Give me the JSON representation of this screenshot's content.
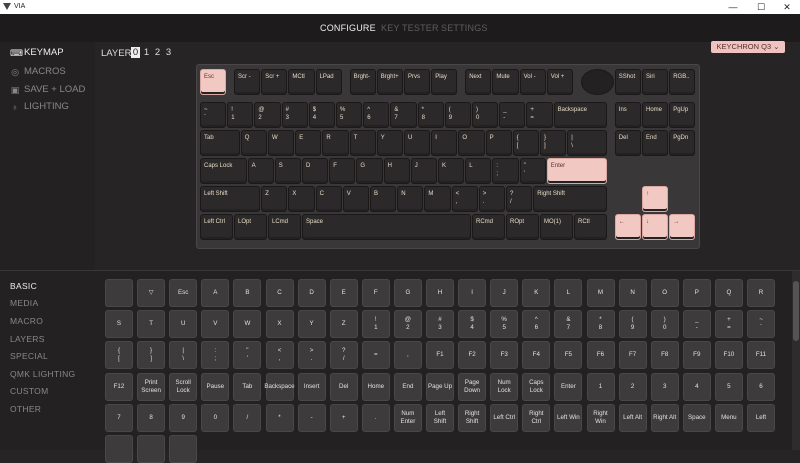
{
  "window": {
    "title": "VIA",
    "controls": [
      "—",
      "☐",
      "✕"
    ]
  },
  "nav": {
    "tabs": [
      "CONFIGURE",
      "KEY TESTER",
      "SETTINGS"
    ],
    "active": 0
  },
  "sidebar": {
    "items": [
      {
        "label": "KEYMAP",
        "icon": "keyboard-icon",
        "active": true
      },
      {
        "label": "MACROS",
        "icon": "macro-icon",
        "active": false
      },
      {
        "label": "SAVE + LOAD",
        "icon": "save-icon",
        "active": false
      },
      {
        "label": "LIGHTING",
        "icon": "lightbulb-icon",
        "active": false
      }
    ]
  },
  "layer": {
    "label": "LAYER",
    "numbers": [
      "0",
      "1",
      "2",
      "3"
    ],
    "selected": 0
  },
  "keyboard_select": {
    "value": "KEYCHRON Q3 ⌄"
  },
  "keyboard_rows": [
    [
      "Esc",
      "Scr -",
      "Scr +",
      "MCtl",
      "LPad",
      "Brght-",
      "Brght+",
      "Prvs",
      "Play",
      "Next",
      "Mute",
      "Vol -",
      "Vol +",
      "",
      "SShot",
      "Siri",
      "RGB.."
    ],
    [
      "~\n`",
      "!\n1",
      "@\n2",
      "#\n3",
      "$\n4",
      "%\n5",
      "^\n6",
      "&\n7",
      "*\n8",
      "(\n9",
      ")\n0",
      "_\n-",
      "+\n=",
      "Backspace",
      "Ins",
      "Home",
      "PgUp"
    ],
    [
      "Tab",
      "Q",
      "W",
      "E",
      "R",
      "T",
      "Y",
      "U",
      "I",
      "O",
      "P",
      "{\n[",
      "}\n]",
      "|\n\\",
      "Del",
      "End",
      "PgDn"
    ],
    [
      "Caps Lock",
      "A",
      "S",
      "D",
      "F",
      "G",
      "H",
      "J",
      "K",
      "L",
      ":\n;",
      "\"\n'",
      "Enter"
    ],
    [
      "Left Shift",
      "Z",
      "X",
      "C",
      "V",
      "B",
      "N",
      "M",
      "<\n,",
      ">\n.",
      "?\n/",
      "Right Shift",
      "↑"
    ],
    [
      "Left Ctrl",
      "LOpt",
      "LCmd",
      "Space",
      "RCmd",
      "ROpt",
      "MO(1)",
      "RCtl",
      "←",
      "↓",
      "→"
    ]
  ],
  "categories": {
    "items": [
      "BASIC",
      "MEDIA",
      "MACRO",
      "LAYERS",
      "SPECIAL",
      "QMK LIGHTING",
      "CUSTOM",
      "OTHER"
    ],
    "active": 0
  },
  "palette_rows": [
    [
      "",
      "▽",
      "Esc",
      "A",
      "B",
      "C",
      "D",
      "E",
      "F",
      "G",
      "H",
      "I",
      "J",
      "K",
      "L",
      "M",
      "N",
      "O",
      "P",
      "Q",
      "R"
    ],
    [
      "S",
      "T",
      "U",
      "V",
      "W",
      "X",
      "Y",
      "Z",
      "!\n1",
      "@\n2",
      "#\n3",
      "$\n4",
      "%\n5",
      "^\n6",
      "&\n7",
      "*\n8",
      "(\n9",
      ")\n0",
      "_\n-",
      "+\n=",
      "~\n`"
    ],
    [
      "{\n[",
      "}\n]",
      "|\n\\",
      ":\n;",
      "\"\n'",
      "<\n,",
      ">\n.",
      "?\n/",
      "=",
      ",",
      "F1",
      "F2",
      "F3",
      "F4",
      "F5",
      "F6",
      "F7",
      "F8",
      "F9",
      "F10",
      "F11"
    ],
    [
      "F12",
      "Print\nScreen",
      "Scroll\nLock",
      "Pause",
      "Tab",
      "Backspace",
      "Insert",
      "Del",
      "Home",
      "End",
      "Page Up",
      "Page\nDown",
      "Num\nLock",
      "Caps\nLock",
      "Enter",
      "1",
      "2",
      "3",
      "4",
      "5",
      "6"
    ],
    [
      "7",
      "8",
      "9",
      "0",
      "/",
      "*",
      "-",
      "+",
      ".",
      "Num\nEnter",
      "Left\nShift",
      "Right\nShift",
      "Left Ctrl",
      "Right\nCtrl",
      "Left Win",
      "Right\nWin",
      "Left Alt",
      "Right Alt",
      "Space",
      "Menu",
      "Left"
    ],
    [
      "",
      "",
      ""
    ]
  ]
}
